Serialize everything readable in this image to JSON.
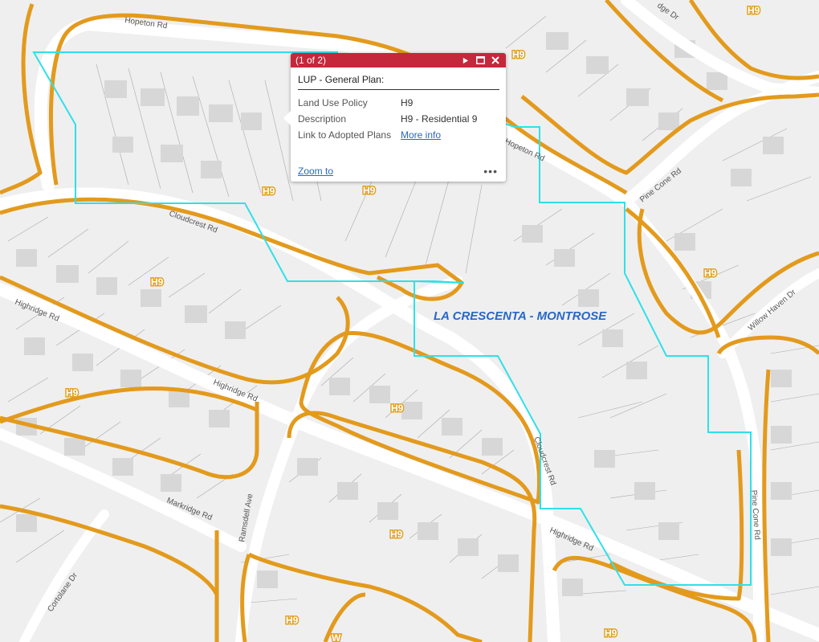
{
  "colors": {
    "zone_outline": "#e39a1c",
    "selection": "#2fe0e8",
    "popup_header": "#c5273b",
    "link": "#2c6ab8",
    "area_label": "#2867c8",
    "road": "#ffffff",
    "land": "#efefef",
    "parcel_line": "#9a9a9a",
    "building": "#d8d8d8"
  },
  "streets": {
    "hopeton_nw": "Hopeton Rd",
    "hopeton_ne": "Hopeton Rd",
    "cloudcrest_nw": "Cloudcrest Rd",
    "cloudcrest_se": "Cloudcrest Rd",
    "highridge_w": "Highridge Rd",
    "highridge_mid": "Highridge Rd",
    "highridge_se": "Highridge Rd",
    "markridge": "Markridge Rd",
    "ramsdell": "Ramsdell Ave",
    "pine_cone_n": "Pine Cone Rd",
    "pine_cone_e": "Pine Cone Rd",
    "willow_haven": "Willow Haven Dr",
    "ridge_dr": "dge Dr",
    "cortolane": "Cortolane Dr"
  },
  "zones": [
    "H9",
    "H9",
    "H9",
    "H9",
    "H9",
    "H9",
    "H9",
    "H9",
    "H9",
    "H9",
    "H9",
    "H9"
  ],
  "partial_w": "W",
  "area_label": "LA CRESCENTA - MONTROSE",
  "popup": {
    "count": "(1 of 2)",
    "title": "LUP - General Plan:",
    "fields": [
      {
        "key": "Land Use Policy",
        "value": "H9"
      },
      {
        "key": "Description",
        "value": "H9 - Residential 9"
      },
      {
        "key": "Link to Adopted Plans",
        "value": "More info"
      }
    ],
    "zoom_label": "Zoom to",
    "more_label": "•••",
    "icons": [
      "play-icon",
      "maximize-icon",
      "close-icon"
    ]
  }
}
